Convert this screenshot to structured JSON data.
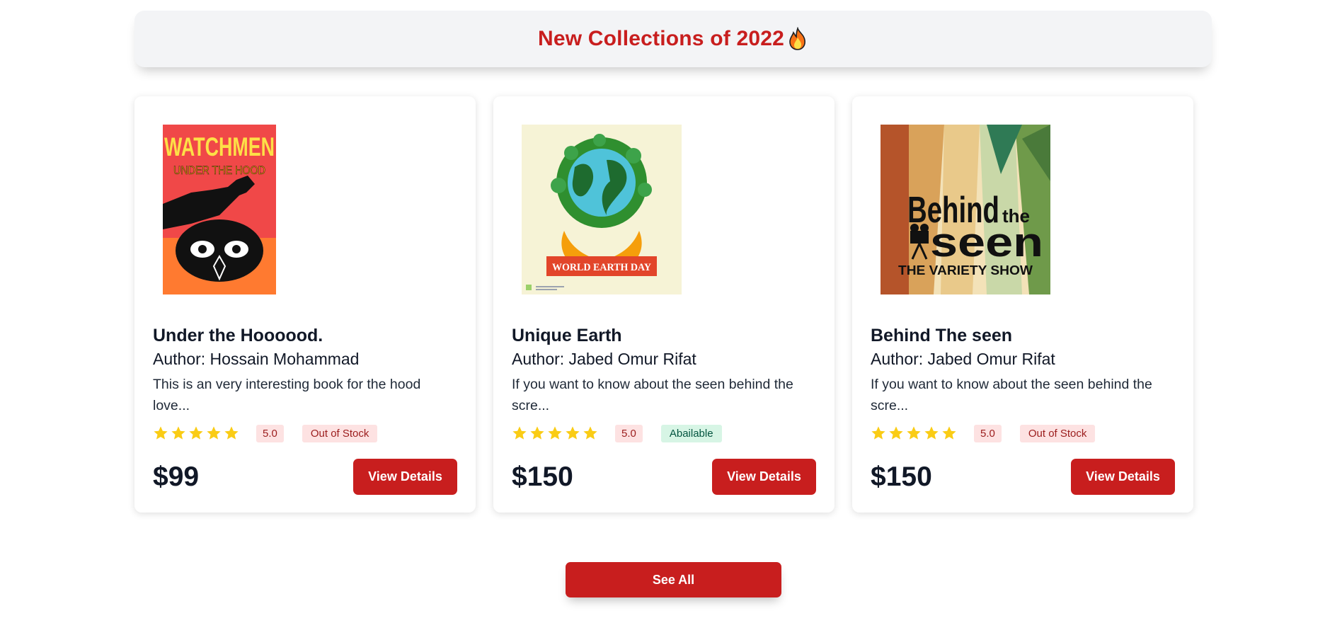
{
  "header": {
    "title": "New Collections of 2022",
    "icon": "fire-icon"
  },
  "books": [
    {
      "title": "Under the Hoooood.",
      "author": "Author: Hossain Mohammad",
      "description": "This is an very interesting book for the hood love...",
      "rating": "5.0",
      "stars": 5,
      "stock": "Out of Stock",
      "price": "$99",
      "button": "View Details",
      "cover": {
        "line1": "WATCHMEN",
        "line2": "UNDER THE HOOD"
      }
    },
    {
      "title": "Unique Earth",
      "author": "Author: Jabed Omur Rifat",
      "description": "If you want to know about the seen behind the scre...",
      "rating": "5.0",
      "stars": 5,
      "stock": "Abailable",
      "price": "$150",
      "button": "View Details",
      "cover": {
        "line1": "WORLD EARTH DAY"
      }
    },
    {
      "title": "Behind The seen",
      "author": "Author: Jabed Omur Rifat",
      "description": "If you want to know about the seen behind the scre...",
      "rating": "5.0",
      "stars": 5,
      "stock": "Out of Stock",
      "price": "$150",
      "button": "View Details",
      "cover": {
        "line1": "Behind",
        "line2": "the",
        "line3": "seen",
        "line4": "THE VARIETY SHOW"
      }
    }
  ],
  "footer": {
    "see_all": "See All"
  },
  "colors": {
    "accent": "#c81e1e",
    "star": "#facc15",
    "banner_bg": "#f3f4f6"
  }
}
